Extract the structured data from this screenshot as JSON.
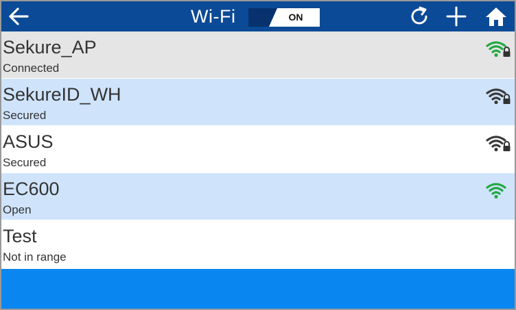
{
  "header": {
    "title": "Wi-Fi",
    "toggle_label": "ON",
    "icons": {
      "back": "arrow-left-icon",
      "refresh": "refresh-icon",
      "add": "plus-icon",
      "home": "home-icon"
    }
  },
  "networks": [
    {
      "name": "Sekure_AP",
      "status": "Connected",
      "bg": "#e5e5e5",
      "signal_color": "#22a843",
      "signal_level": 4,
      "locked": true
    },
    {
      "name": "SekureID_WH",
      "status": "Secured",
      "bg": "#cfe4fb",
      "signal_color": "#3a3a3a",
      "signal_level": 4,
      "locked": true
    },
    {
      "name": "ASUS",
      "status": "Secured",
      "bg": "#ffffff",
      "signal_color": "#3a3a3a",
      "signal_level": 4,
      "locked": true
    },
    {
      "name": "EC600",
      "status": "Open",
      "bg": "#cfe4fb",
      "signal_color": "#22a843",
      "signal_level": 4,
      "locked": false
    },
    {
      "name": "Test",
      "status": "Not in range",
      "bg": "#ffffff",
      "signal_color": null,
      "signal_level": 0,
      "locked": false
    }
  ],
  "colors": {
    "header_bg": "#0b4a96",
    "toggle_bg": "#07326d",
    "bottom_band": "#0a86f0",
    "signal_connected": "#22a843",
    "signal_secured": "#3a3a3a"
  }
}
